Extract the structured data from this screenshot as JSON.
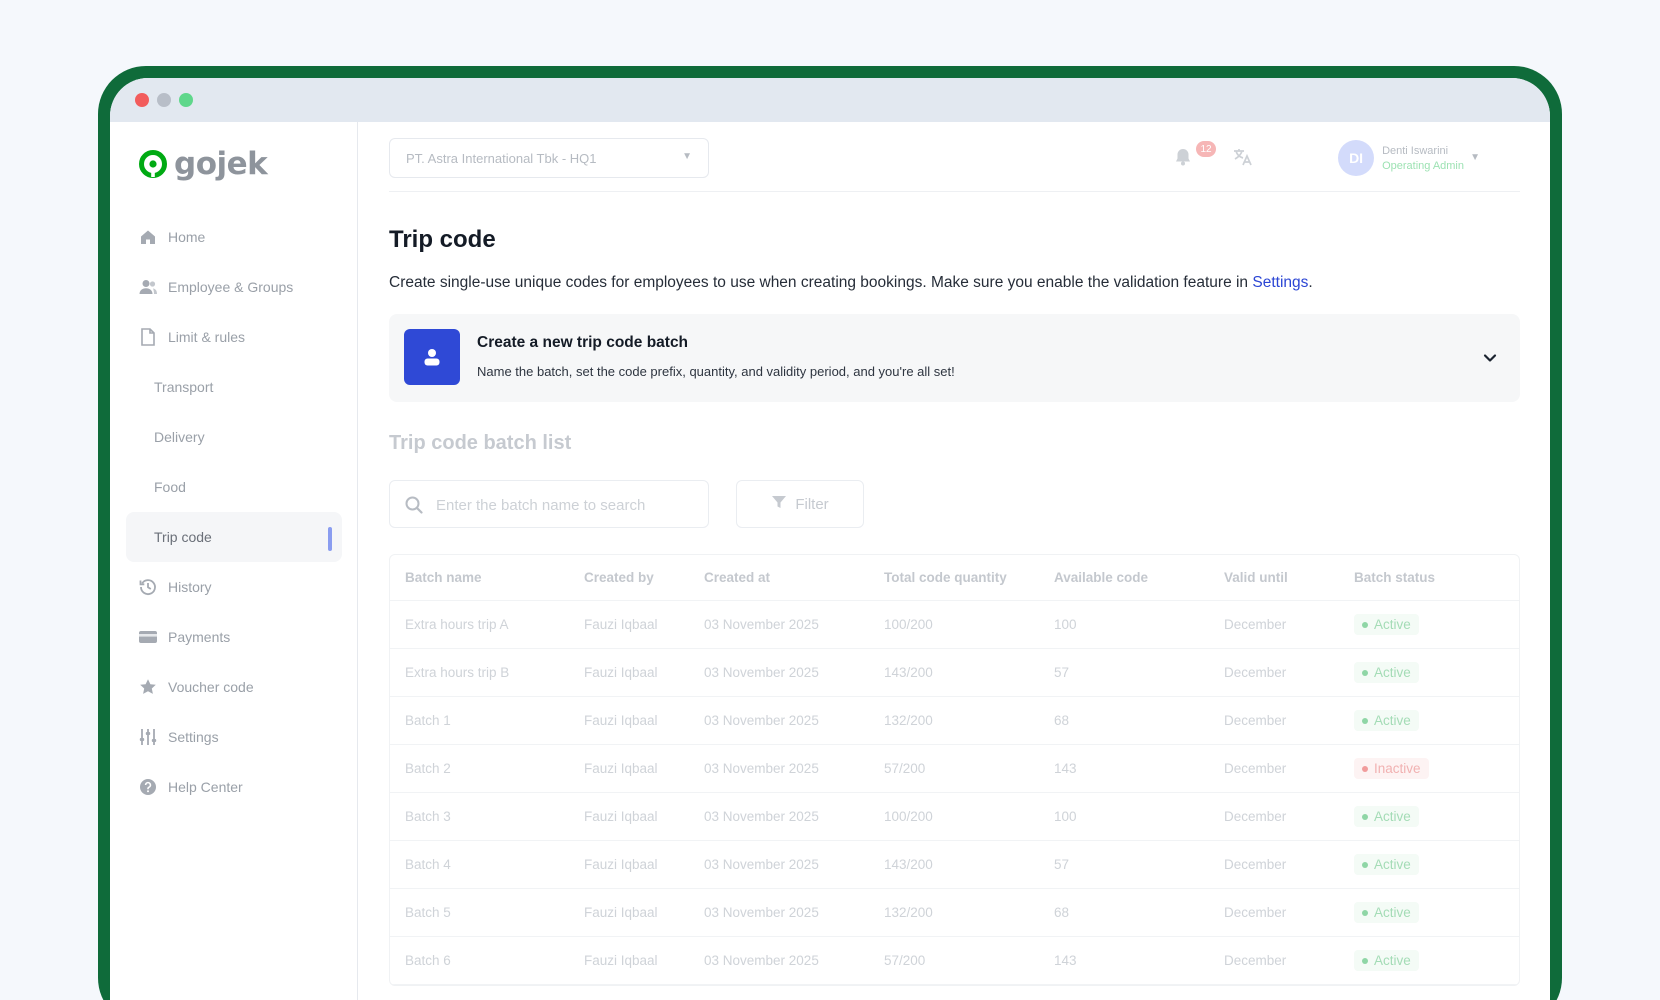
{
  "brand": {
    "name": "gojek",
    "color": "#00aa13"
  },
  "window": {
    "frame_color": "#0f6b3a"
  },
  "sidebar": {
    "items": [
      {
        "label": "Home",
        "icon": "home-icon",
        "sub": false
      },
      {
        "label": "Employee & Groups",
        "icon": "users-icon",
        "sub": false
      },
      {
        "label": "Limit & rules",
        "icon": "document-icon",
        "sub": false
      },
      {
        "label": "Transport",
        "sub": true
      },
      {
        "label": "Delivery",
        "sub": true
      },
      {
        "label": "Food",
        "sub": true
      },
      {
        "label": "Trip code",
        "sub": true,
        "active": true
      },
      {
        "label": "History",
        "icon": "history-icon",
        "sub": false
      },
      {
        "label": "Payments",
        "icon": "card-icon",
        "sub": false
      },
      {
        "label": "Voucher code",
        "icon": "star-icon",
        "sub": false
      },
      {
        "label": "Settings",
        "icon": "sliders-icon",
        "sub": false
      },
      {
        "label": "Help Center",
        "icon": "help-icon",
        "sub": false
      }
    ]
  },
  "topbar": {
    "company": "PT. Astra International Tbk - HQ1",
    "notification_count": "12",
    "user": {
      "initials": "DI",
      "name": "Denti Iswarini",
      "role": "Operating Admin"
    }
  },
  "page": {
    "title": "Trip code",
    "description_prefix": "Create single-use unique codes for employees to use when creating bookings. Make sure you enable the validation feature in ",
    "description_link": "Settings",
    "description_suffix": "."
  },
  "create_card": {
    "title": "Create a new trip code batch",
    "subtitle": "Name the batch, set the code prefix, quantity, and validity period, and you're all set!",
    "accent": "#2f49d6"
  },
  "list": {
    "title": "Trip code batch list",
    "search_placeholder": "Enter the batch name to search",
    "filter_label": "Filter",
    "columns": [
      "Batch name",
      "Created by",
      "Created at",
      "Total code quantity",
      "Available code",
      "Valid until",
      "Batch status"
    ],
    "rows": [
      {
        "name": "Extra hours trip A",
        "created_by": "Fauzi Iqbaal",
        "created_at": "03 November 2025",
        "total": "100/200",
        "available": "100",
        "valid_until": "December",
        "status": "Active",
        "status_type": "active"
      },
      {
        "name": "Extra hours trip B",
        "created_by": "Fauzi Iqbaal",
        "created_at": "03 November 2025",
        "total": "143/200",
        "available": "57",
        "valid_until": "December",
        "status": "Active",
        "status_type": "active"
      },
      {
        "name": "Batch 1",
        "created_by": "Fauzi Iqbaal",
        "created_at": "03 November 2025",
        "total": "132/200",
        "available": "68",
        "valid_until": "December",
        "status": "Active",
        "status_type": "active"
      },
      {
        "name": "Batch 2",
        "created_by": "Fauzi Iqbaal",
        "created_at": "03 November 2025",
        "total": "57/200",
        "available": "143",
        "valid_until": "December",
        "status": "Inactive",
        "status_type": "inactive"
      },
      {
        "name": "Batch 3",
        "created_by": "Fauzi Iqbaal",
        "created_at": "03 November 2025",
        "total": "100/200",
        "available": "100",
        "valid_until": "December",
        "status": "Active",
        "status_type": "active"
      },
      {
        "name": "Batch 4",
        "created_by": "Fauzi Iqbaal",
        "created_at": "03 November 2025",
        "total": "143/200",
        "available": "57",
        "valid_until": "December",
        "status": "Active",
        "status_type": "active"
      },
      {
        "name": "Batch 5",
        "created_by": "Fauzi Iqbaal",
        "created_at": "03 November 2025",
        "total": "132/200",
        "available": "68",
        "valid_until": "December",
        "status": "Active",
        "status_type": "active"
      },
      {
        "name": "Batch 6",
        "created_by": "Fauzi Iqbaal",
        "created_at": "03 November 2025",
        "total": "57/200",
        "available": "143",
        "valid_until": "December",
        "status": "Active",
        "status_type": "active"
      }
    ]
  }
}
